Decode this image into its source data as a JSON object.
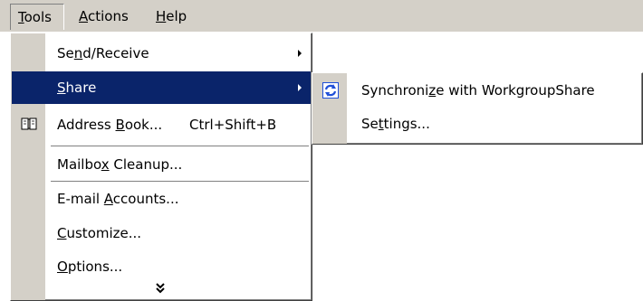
{
  "menubar": {
    "tools": {
      "label": "Tools",
      "mnemonic": "T",
      "rest": "ools"
    },
    "actions": {
      "label": "Actions",
      "mnemonic": "A",
      "rest": "ctions"
    },
    "help": {
      "label": "Help",
      "mnemonic": "H",
      "rest": "elp"
    }
  },
  "tools_menu": {
    "items": [
      {
        "label": "Send/Receive",
        "pre": "Se",
        "mn": "n",
        "post": "d/Receive",
        "has_submenu": true
      },
      {
        "label": "Share",
        "pre": "",
        "mn": "S",
        "post": "hare",
        "has_submenu": true,
        "selected": true
      },
      {
        "label": "Address Book...",
        "pre": "Address ",
        "mn": "B",
        "post": "ook...",
        "shortcut": "Ctrl+Shift+B",
        "icon": "address-book-icon"
      },
      {
        "label": "Mailbox Cleanup...",
        "pre": "Mailbo",
        "mn": "x",
        "post": " Cleanup..."
      },
      {
        "label": "E-mail Accounts...",
        "pre": "E-mail ",
        "mn": "A",
        "post": "ccounts..."
      },
      {
        "label": "Customize...",
        "pre": "",
        "mn": "C",
        "post": "ustomize..."
      },
      {
        "label": "Options...",
        "pre": "",
        "mn": "O",
        "post": "ptions..."
      }
    ],
    "expand_icon": "double-chevron-down-icon"
  },
  "share_submenu": {
    "items": [
      {
        "label": "Synchronize with WorkgroupShare",
        "pre": "Synchroni",
        "mn": "z",
        "post": "e with WorkgroupShare",
        "icon": "sync-icon"
      },
      {
        "label": "Settings...",
        "pre": "Se",
        "mn": "t",
        "post": "tings..."
      }
    ]
  },
  "colors": {
    "menu_face": "#d4d0c8",
    "highlight": "#0a246a",
    "highlight_text": "#ffffff",
    "sync_icon": "#1f4fd8"
  }
}
